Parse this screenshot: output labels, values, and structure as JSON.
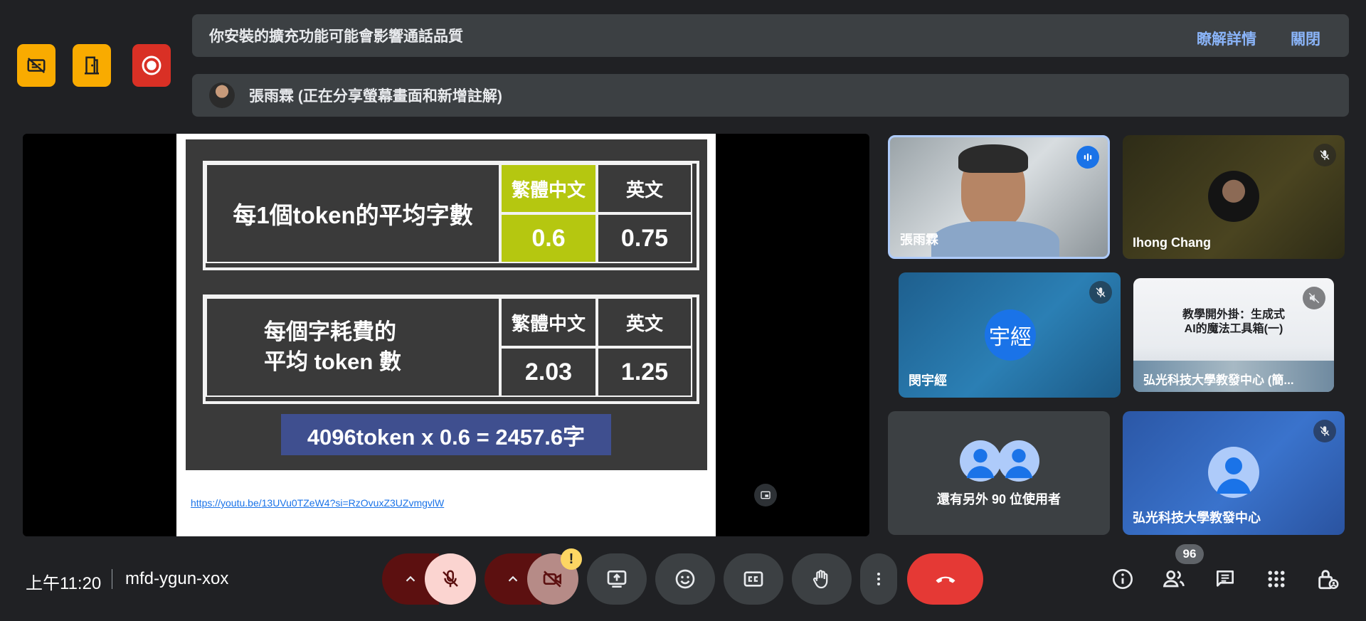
{
  "indicators": [
    {
      "icon": "caption-off-icon",
      "color": "#f9ab00"
    },
    {
      "icon": "door-exit-icon",
      "color": "#f9ab00"
    },
    {
      "icon": "record-icon",
      "color": "#d93025"
    }
  ],
  "notice_banner": {
    "text": "你安裝的擴充功能可能會影響通話品質",
    "learn_more": "瞭解詳情",
    "close": "關閉"
  },
  "presenter_banner": {
    "text": "張雨霖 (正在分享螢幕畫面和新增註解)"
  },
  "slide": {
    "table1": {
      "row_header": "每1個token的平均字數",
      "col1": "繁體中文",
      "col2": "英文",
      "val1": "0.6",
      "val2": "0.75"
    },
    "table2": {
      "row_header_line1": "每個字耗費的",
      "row_header_line2": "平均 token 數",
      "col1": "繁體中文",
      "col2": "英文",
      "val1": "2.03",
      "val2": "1.25"
    },
    "formula": "4096token x 0.6 = 2457.6字",
    "link": "https://youtu.be/13UVu0TZeW4?si=RzOvuxZ3UZvmgvlW"
  },
  "participants": [
    {
      "name": "張雨霖",
      "status": "speaking"
    },
    {
      "name": "Ihong Chang",
      "status": "muted"
    },
    {
      "name": "閔宇經",
      "avatar_text": "宇經",
      "status": "muted"
    },
    {
      "name": "弘光科技大學教發中心 (簡...",
      "status": "audio-off",
      "slide_title_1": "教學開外掛：生成式",
      "slide_title_2": "AI的魔法工具箱(一)"
    },
    {
      "name": "還有另外 90 位使用者"
    },
    {
      "name": "弘光科技大學教發中心",
      "status": "muted"
    }
  ],
  "bottom_bar": {
    "time": "上午11:20",
    "meeting_code": "mfd-ygun-xox",
    "warning_badge": "!",
    "people_count": "96"
  },
  "colors": {
    "background": "#202124",
    "banner": "#3c4043",
    "link": "#8ab4f8",
    "hangup": "#e53935",
    "highlight_cell": "#b5c710"
  }
}
